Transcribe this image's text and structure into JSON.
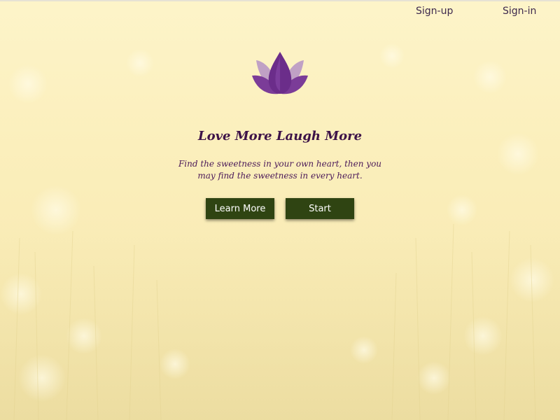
{
  "nav": {
    "signup_label": "Sign-up",
    "signin_label": "Sign-in"
  },
  "hero": {
    "logo_icon": "lotus-icon",
    "title": "Love More Laugh More",
    "tagline": "Find the sweetness in your own heart, then you may find the sweetness in every heart.",
    "learn_more_label": "Learn More",
    "start_label": "Start"
  },
  "colors": {
    "background": "#fbefbc",
    "title_text": "#3d1348",
    "nav_text": "#3e2a4e",
    "button_bg": "#2f4412",
    "button_text": "#ffffff",
    "lotus_dark": "#6b2d8a",
    "lotus_light": "#b593c6"
  }
}
